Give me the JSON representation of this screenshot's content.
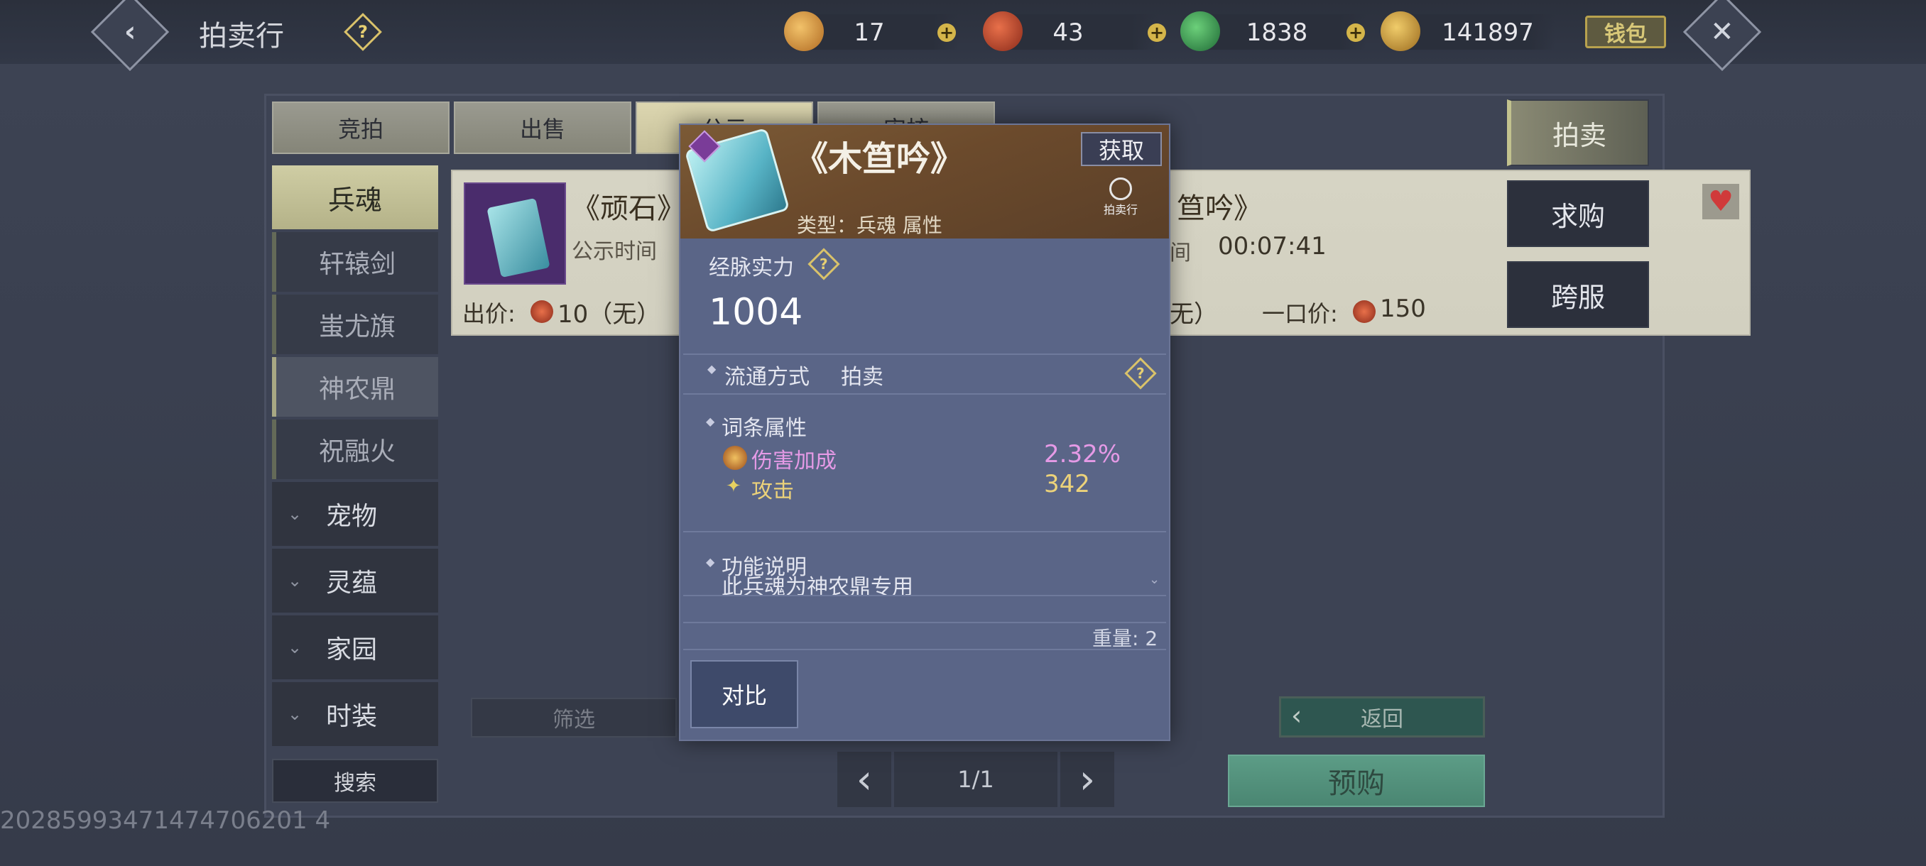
{
  "topbar": {
    "title": "拍卖行",
    "help": "?",
    "back_icon": "chevron-left-icon",
    "close_icon": "close-icon",
    "currencies": [
      {
        "icon": "gold-ingot-icon",
        "value": "17",
        "color": "#c98a3a"
      },
      {
        "icon": "red-coin-icon",
        "value": "43",
        "color": "#c0503a"
      },
      {
        "icon": "jade-icon",
        "value": "1838",
        "color": "#3f9a5a"
      },
      {
        "icon": "gold-leaf-icon",
        "value": "141897",
        "color": "#c9a040"
      }
    ],
    "plus": "+",
    "wallet_label": "钱包"
  },
  "tabs": [
    {
      "label": "竞拍"
    },
    {
      "label": "出售"
    },
    {
      "label": "公示",
      "active": true
    },
    {
      "label": "审核"
    }
  ],
  "categories": [
    {
      "label": "兵魂",
      "type": "main",
      "active": true
    },
    {
      "label": "轩辕剑",
      "type": "sub"
    },
    {
      "label": "蚩尤旗",
      "type": "sub"
    },
    {
      "label": "神农鼎",
      "type": "sub",
      "active": true
    },
    {
      "label": "祝融火",
      "type": "sub"
    },
    {
      "label": "宠物",
      "type": "expand"
    },
    {
      "label": "灵蕴",
      "type": "expand"
    },
    {
      "label": "家园",
      "type": "expand"
    },
    {
      "label": "时装",
      "type": "expand"
    }
  ],
  "cards": [
    {
      "name": "《顽石》",
      "time_label": "公示时间",
      "price_label": "出价:",
      "price": "10（无）"
    },
    {
      "name": "笪吟》",
      "time_label": "间",
      "time": "00:07:41",
      "price_label": "无）",
      "buyout_label": "一口价:",
      "buyout": "150",
      "heart_icon": "heart-icon"
    }
  ],
  "filter_label": "筛选",
  "return_label": "返回",
  "search_label": "搜索",
  "pagination": {
    "text": "1/1"
  },
  "preorder_label": "预购",
  "side_tabs": [
    {
      "label": "拍卖",
      "active": true
    },
    {
      "label": "求购"
    },
    {
      "label": "跨服"
    }
  ],
  "uid": "20285993471474706201 4",
  "popup": {
    "title": "《木笪吟》",
    "obtain_label": "获取",
    "auction_icon_label": "拍卖行",
    "type_line": "类型：兵魂 属性",
    "power_label": "经脉实力",
    "power_value": "1004",
    "circulation_label": "流通方式",
    "circulation_value": "拍卖",
    "affix_label": "词条属性",
    "affixes": [
      {
        "name": "伤害加成",
        "value": "2.32%",
        "color": "#e59ae6"
      },
      {
        "name": "攻击",
        "value": "342",
        "color": "#ecd27a"
      }
    ],
    "function_label": "功能说明",
    "function_text": "此兵魂为神农鼎专用",
    "weight": "重量: 2",
    "compare_label": "对比"
  }
}
